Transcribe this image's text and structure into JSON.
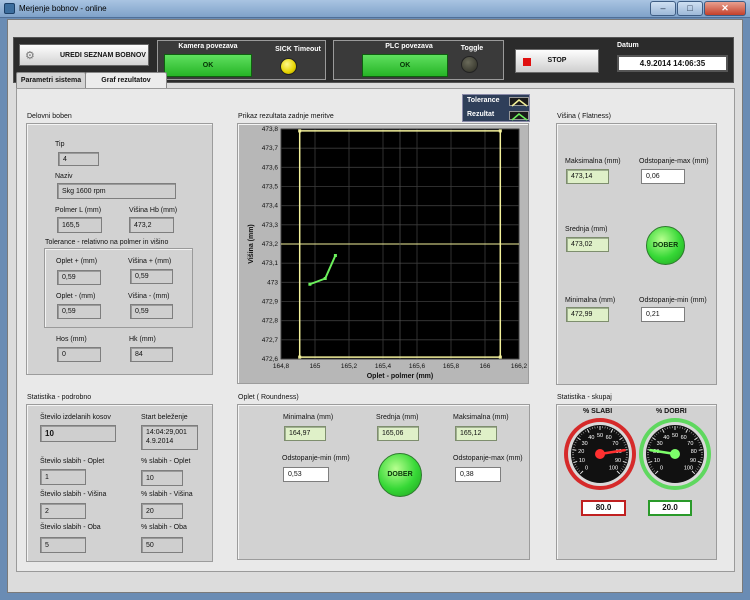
{
  "window": {
    "title": "Merjenje bobnov - online"
  },
  "header": {
    "nav_button": "UREDI SEZNAM BOBNOV",
    "camera": {
      "label": "Kamera povezava",
      "status": "OK",
      "sick_label": "SICK Timeout"
    },
    "plc": {
      "label": "PLC povezava",
      "status": "OK",
      "toggle_label": "Toggle"
    },
    "stop_label": "STOP",
    "date_label": "Datum",
    "date_value": "4.9.2014 14:06:35"
  },
  "tabs": [
    "Parametri sistema",
    "Graf rezultatov"
  ],
  "delovni": {
    "title": "Delovni boben",
    "tip_label": "Tip",
    "tip": "4",
    "naziv_label": "Naziv",
    "naziv": "Skg 1600 rpm",
    "polmer_label": "Polmer L (mm)",
    "polmer": "165,5",
    "visina_label": "Višina Hb (mm)",
    "visina": "473,2",
    "tol_title": "Tolerance - relativno na polmer in višino",
    "oplet_plus_label": "Oplet + (mm)",
    "oplet_plus": "0,59",
    "visina_plus_label": "Višina + (mm)",
    "visina_plus": "0,59",
    "oplet_minus_label": "Oplet - (mm)",
    "oplet_minus": "0,59",
    "visina_minus_label": "Višina - (mm)",
    "visina_minus": "0,59",
    "hos_label": "Hos (mm)",
    "hos": "0",
    "hk_label": "Hk (mm)",
    "hk": "84"
  },
  "stat_local": {
    "title": "Statistika - podrobno",
    "count_label": "Število izdelanih kosov",
    "count": "10",
    "start_label": "Start beleženje",
    "start_time": "14:04:29,001",
    "start_date": "4.9.2014",
    "weak_oplet_label": "Število slabih - Oplet",
    "weak_oplet": "1",
    "pct_oplet_label": "% slabih - Oplet",
    "pct_oplet": "10",
    "weak_visina_label": "Število slabih - Višina",
    "weak_visina": "2",
    "pct_visina_label": "% slabih - Višina",
    "pct_visina": "20",
    "weak_oba_label": "Število slabih - Oba",
    "weak_oba": "5",
    "pct_oba_label": "% slabih - Oba",
    "pct_oba": "50"
  },
  "graph": {
    "title": "Prikaz rezultata zadnje meritve",
    "legend": [
      "Tolerance",
      "Rezultat"
    ]
  },
  "chart_data": {
    "type": "line",
    "xlabel": "Oplet - polmer (mm)",
    "ylabel": "Višina (mm)",
    "xlim": [
      164.8,
      166.2
    ],
    "ylim": [
      472.6,
      473.8
    ],
    "x_ticks": [
      "164,8",
      "165",
      "165,2",
      "165,4",
      "165,6",
      "165,8",
      "166",
      "166,2"
    ],
    "y_ticks": [
      "472,6",
      "472,7",
      "472,8",
      "472,9",
      "473",
      "473,1",
      "473,2",
      "473,3",
      "473,4",
      "473,5",
      "473,6",
      "473,7",
      "473,8"
    ],
    "grid": true,
    "series": [
      {
        "name": "Tolerance",
        "color": "#f2f09a",
        "x": [
          164.91,
          166.09,
          166.09,
          164.91,
          164.91
        ],
        "y": [
          472.61,
          472.61,
          473.79,
          473.79,
          472.61
        ]
      },
      {
        "name": "Rezultat",
        "color": "#6cf05c",
        "x": [
          164.97,
          165.06,
          165.12
        ],
        "y": [
          472.99,
          473.02,
          473.14
        ]
      }
    ],
    "crosshair": {
      "x": 165.5,
      "y": 473.2
    }
  },
  "visina": {
    "title": "Višina ( Flatness)",
    "max_label": "Maksimalna (mm)",
    "max": "473,14",
    "odst_max_label": "Odstopanje-max (mm)",
    "odst_max": "0,06",
    "sred_label": "Srednja (mm)",
    "sred": "473,02",
    "status": "DOBER",
    "min_label": "Minimalna (mm)",
    "min": "472,99",
    "odst_min_label": "Odstopanje-min (mm)",
    "odst_min": "0,21"
  },
  "oplet": {
    "title": "Oplet ( Roundness)",
    "min_label": "Minimalna (mm)",
    "min": "164,97",
    "sred_label": "Srednja (mm)",
    "sred": "165,06",
    "max_label": "Maksimalna (mm)",
    "max": "165,12",
    "odst_min_label": "Odstopanje-min (mm)",
    "odst_min": "0,53",
    "odst_max_label": "Odstopanje-max (mm)",
    "odst_max": "0,38",
    "status": "DOBER"
  },
  "stat_total": {
    "title": "Statistika - skupaj",
    "slabi_label": "% SLABI",
    "slabi_value": "80.0",
    "slabi": 80,
    "dobri_label": "% DOBRI",
    "dobri_value": "20.0",
    "dobri": 20,
    "gauge_ticks": [
      "0",
      "10",
      "20",
      "30",
      "40",
      "50",
      "60",
      "70",
      "80",
      "90",
      "100"
    ]
  }
}
